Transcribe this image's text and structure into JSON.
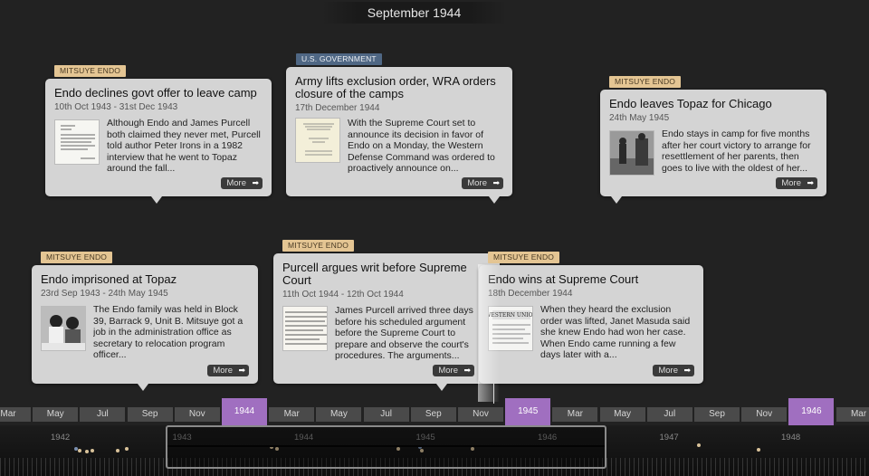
{
  "header": {
    "current_date": "September 1944"
  },
  "cards": [
    {
      "id": "card-endo-declines",
      "tag": "MITSUYE ENDO",
      "title": "Endo declines govt offer to leave camp",
      "dates": "10th Oct 1943 - 31st Dec 1943",
      "text": "Although Endo and James Purcell both claimed they never met, Purcell told author Peter Irons in a 1982 interview that he went to Topaz around the fall...",
      "more": "More",
      "thumb": "document-icon"
    },
    {
      "id": "card-army-lifts",
      "tag": "U.S. GOVERNMENT",
      "title": "Army lifts exclusion order, WRA orders closure of the camps",
      "dates": "17th December 1944",
      "text": "With the Supreme Court set to announce its decision in favor of Endo on a Monday, the Western Defense Command was ordered to proactively announce on...",
      "more": "More",
      "thumb": "proclamation-icon"
    },
    {
      "id": "card-endo-leaves",
      "tag": "MITSUYE ENDO",
      "title": "Endo leaves Topaz for Chicago",
      "dates": "24th May 1945",
      "text": "Endo stays in camp for five months after her court victory to arrange for resettlement of her parents, then goes to live with the oldest of her...",
      "more": "More",
      "thumb": "photo-icon"
    },
    {
      "id": "card-endo-imprisoned",
      "tag": "MITSUYE ENDO",
      "title": "Endo imprisoned at Topaz",
      "dates": "23rd Sep 1943 - 24th May 1945",
      "text": "The Endo family was held in Block 39, Barrack 9, Unit B. Mitsuye got a job in the administration office as secretary to relocation program officer...",
      "more": "More",
      "thumb": "photo-icon"
    },
    {
      "id": "card-purcell-argues",
      "tag": "MITSUYE ENDO",
      "title": "Purcell argues writ before Supreme Court",
      "dates": "11th Oct 1944 - 12th Oct 1944",
      "text": "James Purcell arrived three days before his scheduled argument before the Supreme Court to prepare and observe the court's procedures. The arguments...",
      "more": "More",
      "thumb": "document-icon"
    },
    {
      "id": "card-endo-wins",
      "tag": "MITSUYE ENDO",
      "title": "Endo wins at Supreme Court",
      "dates": "18th December 1944",
      "text": "When they heard the exclusion order was lifted, Janet Masuda said she knew Endo had won her case. When Endo came running a few days later with a...",
      "more": "More",
      "thumb": "telegram-icon"
    }
  ],
  "months": [
    "Mar",
    "May",
    "Jul",
    "Sep",
    "Nov",
    "1944",
    "Mar",
    "May",
    "Jul",
    "Sep",
    "Nov",
    "1945",
    "Mar",
    "May",
    "Jul",
    "Sep",
    "Nov",
    "1946",
    "Mar"
  ],
  "overview_years": [
    "1942",
    "1943",
    "1944",
    "1945",
    "1946",
    "1947",
    "1948"
  ],
  "colors": {
    "background": "#222222",
    "card": "#d4d4d4",
    "tag_person": "#e4c593",
    "tag_government": "#4f6784",
    "year_marker": "#a06fc0"
  }
}
